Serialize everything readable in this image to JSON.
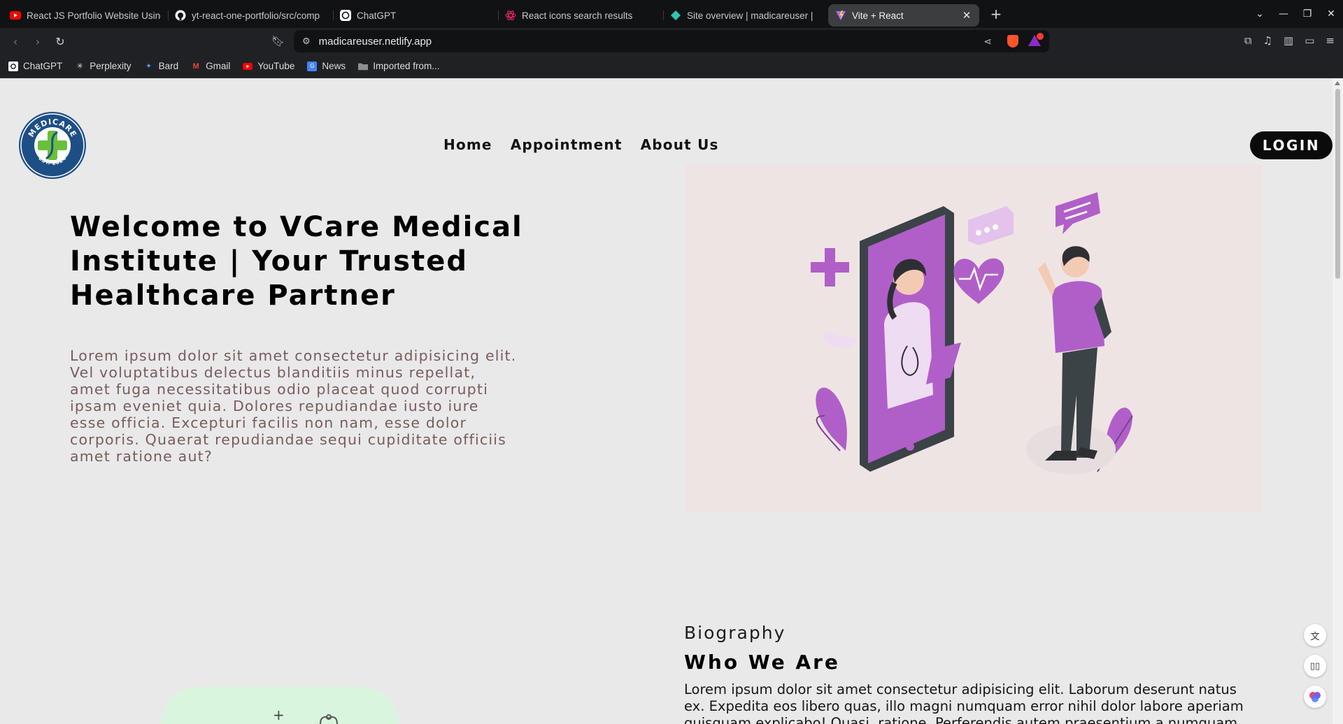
{
  "browser": {
    "tabs": [
      {
        "title": "React JS Portfolio Website Using",
        "favicon": "youtube-icon",
        "color": "#ff0000"
      },
      {
        "title": "yt-react-one-portfolio/src/comp",
        "favicon": "github-icon",
        "color": "#ffffff"
      },
      {
        "title": "ChatGPT",
        "favicon": "chatgpt-icon",
        "color": "#ffffff"
      },
      {
        "title": "React icons search results",
        "favicon": "react-icons-icon",
        "color": "#e91e63"
      },
      {
        "title": "Site overview | madicareuser |",
        "favicon": "netlify-icon",
        "color": "#32c5b0"
      },
      {
        "title": "Vite + React",
        "favicon": "vite-icon",
        "color": "#a86bff"
      }
    ],
    "new_tab_label": "+",
    "url": "madicareuser.netlify.app",
    "bookmarks": [
      {
        "label": "ChatGPT",
        "icon": "chatgpt-icon"
      },
      {
        "label": "Perplexity",
        "icon": "perplexity-icon"
      },
      {
        "label": "Bard",
        "icon": "bard-icon"
      },
      {
        "label": "Gmail",
        "icon": "gmail-icon"
      },
      {
        "label": "YouTube",
        "icon": "youtube-icon"
      },
      {
        "label": "News",
        "icon": "news-icon"
      },
      {
        "label": "Imported from...",
        "icon": "folder-icon"
      }
    ]
  },
  "page": {
    "logo": {
      "top_text": "MEDICARE",
      "bottom_text": "EST. 2024"
    },
    "nav": [
      "Home",
      "Appointment",
      "About Us"
    ],
    "login_label": "LOGIN",
    "hero": {
      "title": "Welcome to VCare Medical Institute | Your Trusted Healthcare Partner",
      "text": "Lorem ipsum dolor sit amet consectetur adipisicing elit. Vel voluptatibus delectus blanditiis minus repellat, amet fuga necessitatibus odio placeat quod corrupti ipsam eveniet quia. Dolores repudiandae iusto iure esse officia. Excepturi facilis non nam, esse dolor corporis. Quaerat repudiandae sequi cupiditate officiis amet ratione aut?"
    },
    "bio": {
      "label": "Biography",
      "title": "Who We Are",
      "text": "Lorem ipsum dolor sit amet consectetur adipisicing elit. Laborum deserunt natus ex. Expedita eos libero quas, illo magni numquam error nihil dolor labore aperiam quisquam explicabo! Quasi, ratione. Perferendis autem praesentium a numquam"
    },
    "colors": {
      "accent": "#b05fc8",
      "dark": "#3b4347",
      "login_bg": "#0b0b0b"
    }
  }
}
